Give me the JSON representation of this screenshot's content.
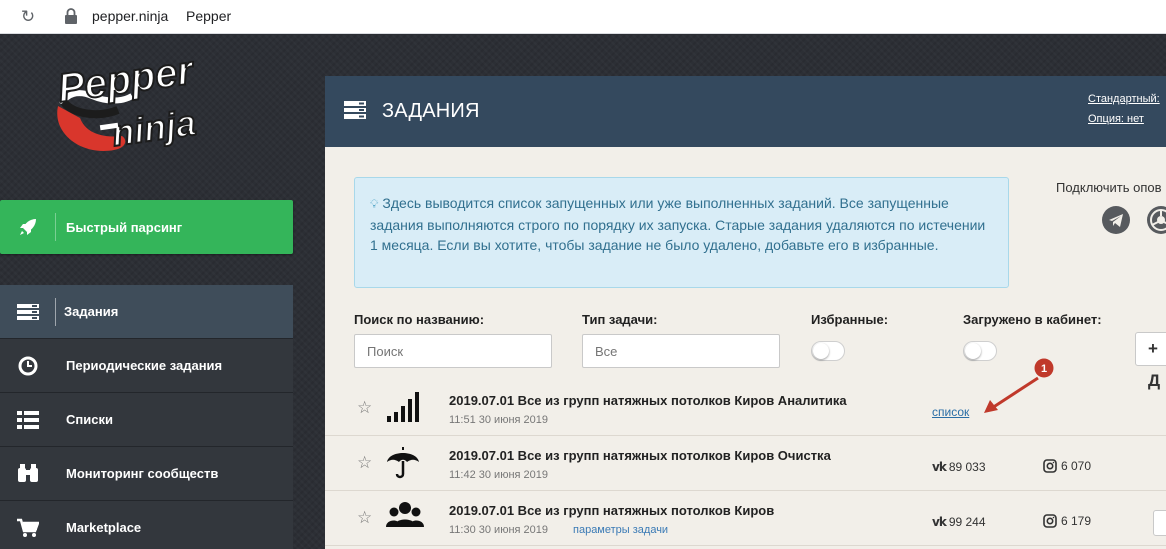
{
  "browser": {
    "url": "pepper.ninja",
    "title": "Pepper"
  },
  "logo": {
    "line1": "Pepper",
    "line2": "ninja"
  },
  "sidebar": {
    "quick_parse": "Быстрый парсинг",
    "items": [
      {
        "label": "Задания",
        "icon": "tasks-icon",
        "active": true
      },
      {
        "label": "Периодические задания",
        "icon": "clock-icon",
        "active": false
      },
      {
        "label": "Списки",
        "icon": "list-icon",
        "active": false
      },
      {
        "label": "Мониторинг сообществ",
        "icon": "binoculars-icon",
        "active": false
      },
      {
        "label": "Marketplace",
        "icon": "cart-icon",
        "active": false
      }
    ]
  },
  "header": {
    "title": "ЗАДАНИЯ",
    "tariff_line1": "Стандартный:",
    "tariff_line2": "Опция: нет"
  },
  "info": {
    "text": "Здесь выводится список запущенных или уже выполненных заданий. Все запущенные задания выполняются строго по порядку их запуска. Старые задания удаляются по истечении 1 месяца. Если вы хотите, чтобы задание не было удалено, добавьте его в избранные."
  },
  "connect": {
    "label": "Подключить опов"
  },
  "filters": {
    "search_label": "Поиск по названию:",
    "search_placeholder": "Поиск",
    "type_label": "Тип задачи:",
    "type_placeholder": "Все",
    "fav_label": "Избранные:",
    "loaded_label": "Загружено в кабинет:",
    "add_label": "+ Д"
  },
  "tasks": [
    {
      "name": "2019.07.01 Все из групп натяжных потолков Киров Аналитика",
      "date": "11:51 30 июня 2019",
      "icon": "signal-bars-icon",
      "link": "список"
    },
    {
      "name": "2019.07.01 Все из групп натяжных потолков Киров Очистка",
      "date": "11:42 30 июня 2019",
      "icon": "umbrella-icon",
      "vk": "89 033",
      "ig": "6 070"
    },
    {
      "name": "2019.07.01 Все из групп натяжных потолков Киров",
      "date": "11:30 30 июня 2019",
      "icon": "users-icon",
      "params": "параметры задачи",
      "vk": "99 244",
      "ig": "6 179"
    }
  ],
  "annotation": {
    "number": "1"
  },
  "colors": {
    "header_bg": "#34495e",
    "quick_bg": "#34b55a",
    "info_bg": "#d9edf7",
    "panel_bg": "#f2efe9",
    "annotation": "#c0392b"
  }
}
